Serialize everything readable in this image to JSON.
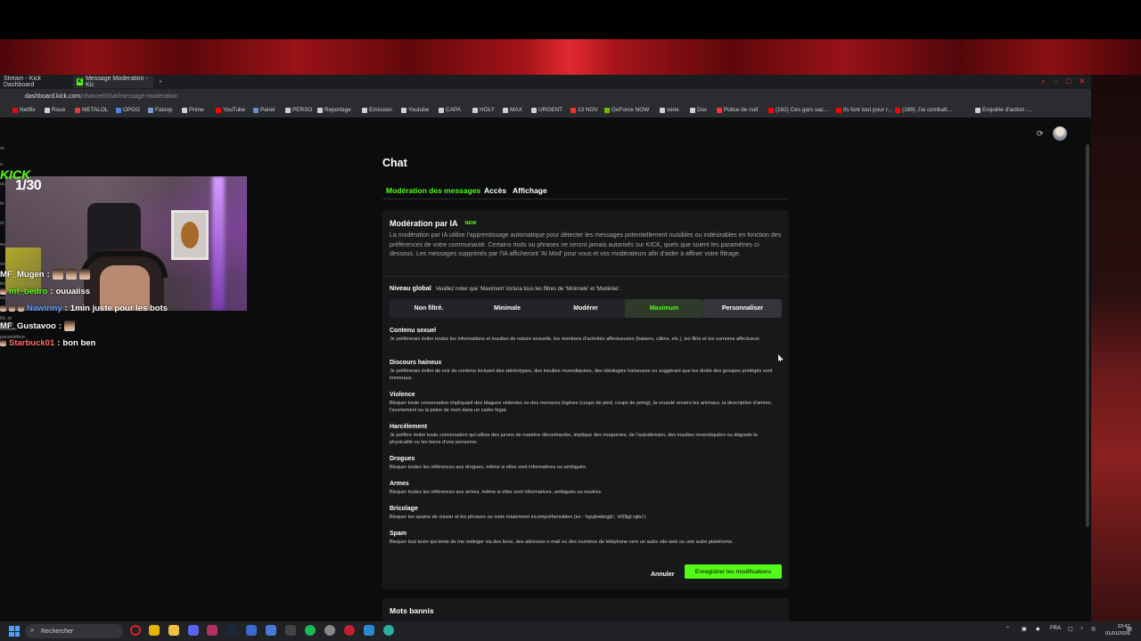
{
  "browser": {
    "tabs": [
      {
        "label": "Stream - Kick Dashboard"
      },
      {
        "label": "Message Moderation - Kic"
      }
    ],
    "new_tab": "+",
    "address": {
      "host": "dashboard.kick.com",
      "path": "/channel/chat/message-moderation"
    },
    "bookmarks": [
      {
        "label": "Netflix",
        "color": "#e50914"
      },
      {
        "label": "Roue",
        "color": "#d0d0d0"
      },
      {
        "label": "METALOL",
        "color": "#e04040"
      },
      {
        "label": "OPGG",
        "color": "#5383e8"
      },
      {
        "label": "Faloop",
        "color": "#7a9ad0"
      },
      {
        "label": "Prime",
        "color": "#d0d0d0"
      },
      {
        "label": "YouTube",
        "color": "#ff0000"
      },
      {
        "label": "Panel",
        "color": "#6a8ad0"
      },
      {
        "label": "PERSO",
        "color": "#d0d0d0"
      },
      {
        "label": "Reportage",
        "color": "#d0d0d0"
      },
      {
        "label": "Emission",
        "color": "#d0d0d0"
      },
      {
        "label": "Youtube",
        "color": "#d0d0d0"
      },
      {
        "label": "CAPA",
        "color": "#d0d0d0"
      },
      {
        "label": "HOLY",
        "color": "#d0d0d0"
      },
      {
        "label": "MAX",
        "color": "#d0d0d0"
      },
      {
        "label": "URGENT",
        "color": "#d0d0d0"
      },
      {
        "label": "13 NOV",
        "color": "#ff3030"
      },
      {
        "label": "GeForce NOW",
        "color": "#76b900"
      },
      {
        "label": "série",
        "color": "#d0d0d0"
      },
      {
        "label": "Doc",
        "color": "#d0d0d0"
      },
      {
        "label": "Police de nuit",
        "color": "#ff3030"
      },
      {
        "label": "(182) Ces gars sac...",
        "color": "#ff0000"
      },
      {
        "label": "Ils font tout pour r...",
        "color": "#ff0000"
      },
      {
        "label": "(189) J'ai combatt...",
        "color": "#ff0000"
      },
      {
        "label": "Enquête d'action :...",
        "color": "#d0d0d0"
      }
    ]
  },
  "page": {
    "title": "Chat",
    "tabs": [
      "Modération des messages",
      "Accès",
      "Affichage"
    ],
    "ia": {
      "heading": "Modération par IA",
      "badge": "NEW",
      "description": "La modération par IA utilise l'apprentissage automatique pour détecter les messages potentiellement nuisibles ou indésirables en fonction des préférences de votre communauté. Certains mots ou phrases ne seront jamais autorisés sur KICK, quels que soient les paramètres ci-dessous. Les messages supprimés par l'IA afficheront 'AI Mod' pour vous et vos modérateurs afin d'aider à affiner votre filtrage."
    },
    "niveau": {
      "label": "Niveau global",
      "note": "Veuillez noter que 'Maximum' inclura tous les filtres de 'Minimale' et 'Modérée'.",
      "options": [
        "Non filtré.",
        "Minimale",
        "Modérer",
        "Maximum",
        "Personnaliser"
      ],
      "selected": "Maximum"
    },
    "categories": [
      {
        "title": "Contenu sexuel",
        "desc": "Je préférerais éviter toutes les informations et insultes de nature sexuelle, les mentions d'activités affectueuses (baisers, câlins, etc.), les flirts et les surnoms affectueux."
      },
      {
        "title": "Discours haineux",
        "desc": "Je préférerais éviter de voir du contenu incluant des stéréotypes, des insultes revendiquées, des idéologies haineuses ou suggérant que les droits des groupes protégés sont immoraux."
      },
      {
        "title": "Violence",
        "desc": "Bloquer toute conversation impliquant des blagues violentes ou des menaces légères (coups de pied, coups de poing), la cruauté envers les animaux, la description d'armes, l'avortement ou la peine de mort dans un cadre légal."
      },
      {
        "title": "Harcèlement",
        "desc": "Je préfère éviter toute conversation qui utilise des jurons de manière décontractée, implique des moqueries, de l'autodérision, des insultes revendiquées ou dégrade la physicalité ou les biens d'une personne."
      },
      {
        "title": "Drogues",
        "desc": "Bloquer toutes les références aux drogues, même si elles sont informatives ou ambiguës."
      },
      {
        "title": "Armes",
        "desc": "Bloquer toutes les références aux armes, même si elles sont informatives, ambiguës ou neutres."
      },
      {
        "title": "Bricolage",
        "desc": "Bloquer les spams de clavier et les phrases ou mots totalement incompréhensibles (ex : 'kgvjbwkirgjb', 'ef2$gt rgbu')."
      },
      {
        "title": "Spam",
        "desc": "Bloquer tout texte qui tente de me rediriger via des liens, des adresses e-mail ou des numéros de téléphone vers un autre site web ou une autre plateforme."
      }
    ],
    "cancel": "Annuler",
    "save": "Enregistrer les modifications",
    "banned_title": "Mots bannis"
  },
  "overlay": {
    "counter": "1/30",
    "kick": "KICK",
    "sidebar_fragments": [
      "re",
      "o",
      "uc",
      "te",
      "ot",
      "eu",
      "ve",
      "tes",
      "communauté",
      "RL et clé du stream",
      "paramètres"
    ],
    "messages": [
      {
        "user": "MF_Mugen",
        "sep": ":",
        "text": "",
        "user_color": "#ffffff"
      },
      {
        "user": "mf_bedro",
        "sep": ":",
        "text": "ouuaiiss",
        "user_color": "#53fc18"
      },
      {
        "user": "Nawirmy",
        "sep": ":",
        "text": "1min juste pour les bots",
        "user_color": "#5aa0ff"
      },
      {
        "user": "MF_Gustavoo",
        "sep": ":",
        "text": "",
        "user_color": "#ffffff"
      },
      {
        "user": "Starbuck01",
        "sep": ":",
        "text": "bon ben",
        "user_color": "#ff6a6a"
      }
    ]
  },
  "taskbar": {
    "search": "Rechercher",
    "lang": "FRA",
    "time": "23:47",
    "date": "01/01/2026"
  }
}
